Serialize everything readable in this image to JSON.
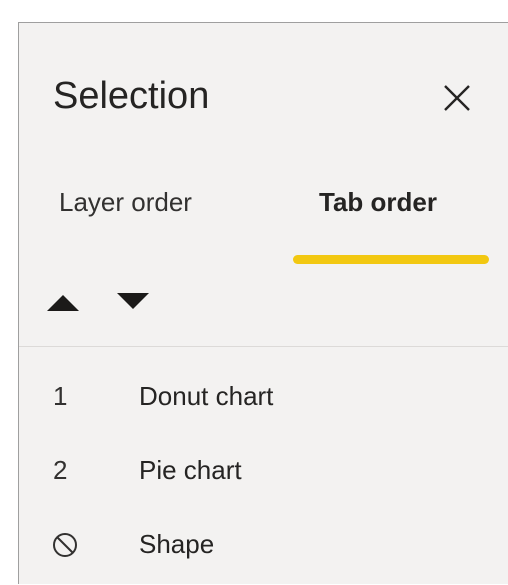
{
  "pane": {
    "title": "Selection",
    "close_icon": "close-icon"
  },
  "tabs": [
    {
      "label": "Layer order",
      "selected": false
    },
    {
      "label": "Tab order",
      "selected": true
    }
  ],
  "colors": {
    "accent": "#f2c811",
    "text": "#252423",
    "pane_bg": "#f3f2f1"
  },
  "toolbar": {
    "move_up_icon": "triangle-up-icon",
    "move_down_icon": "triangle-down-icon"
  },
  "items": [
    {
      "order": "1",
      "name": "Donut chart"
    },
    {
      "order": "2",
      "name": "Pie chart"
    },
    {
      "order_icon": "no-tab-stop-icon",
      "name": "Shape"
    }
  ]
}
